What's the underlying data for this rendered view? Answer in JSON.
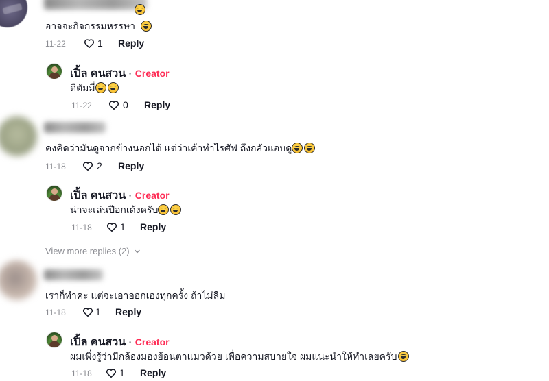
{
  "comments": [
    {
      "text": "อาจจะกิจกรรมหรรษา",
      "date": "11-22",
      "likes": "1",
      "reply_label": "Reply"
    },
    {
      "text": "คงคิดว่ามันดูจากข้างนอกได้ แต่ว่าเค้าทำไรศัฟ ถึงกลัวแอบดู",
      "date": "11-18",
      "likes": "2",
      "reply_label": "Reply"
    },
    {
      "text": "เราก็ทำค่ะ แต่จะเอาออกเองทุกครั้ง ถ้าไม่ลืม",
      "date": "11-18",
      "likes": "1",
      "reply_label": "Reply"
    }
  ],
  "creator_replies": [
    {
      "name": "เปิ้ล คนสวน",
      "separator": "·",
      "tag": "Creator",
      "text": "ดีตัมมี่",
      "date": "11-22",
      "likes": "0",
      "reply_label": "Reply"
    },
    {
      "name": "เปิ้ล คนสวน",
      "separator": "·",
      "tag": "Creator",
      "text": "น่าจะเล่นปีอกเด้งครับ",
      "date": "11-18",
      "likes": "1",
      "reply_label": "Reply"
    },
    {
      "name": "เปิ้ล คนสวน",
      "separator": "·",
      "tag": "Creator",
      "text": "ผมเพิ่งรู้ว่ามีกล้องมองย้อนตาแมวด้วย เพื่อความสบายใจ ผมแนะนำให้ทำเลยครับ",
      "date": "11-18",
      "likes": "1",
      "reply_label": "Reply"
    }
  ],
  "view_more": "View more replies (2)",
  "icons": {
    "like": "heart-outline-icon",
    "expand": "chevron-down-icon",
    "emoji_laugh": "tears-of-joy-emoji",
    "emoji_smile": "smiling-emoji"
  },
  "colors": {
    "creator_tag": "#fe2c55",
    "meta": "#8a8b91",
    "text": "#161823"
  }
}
